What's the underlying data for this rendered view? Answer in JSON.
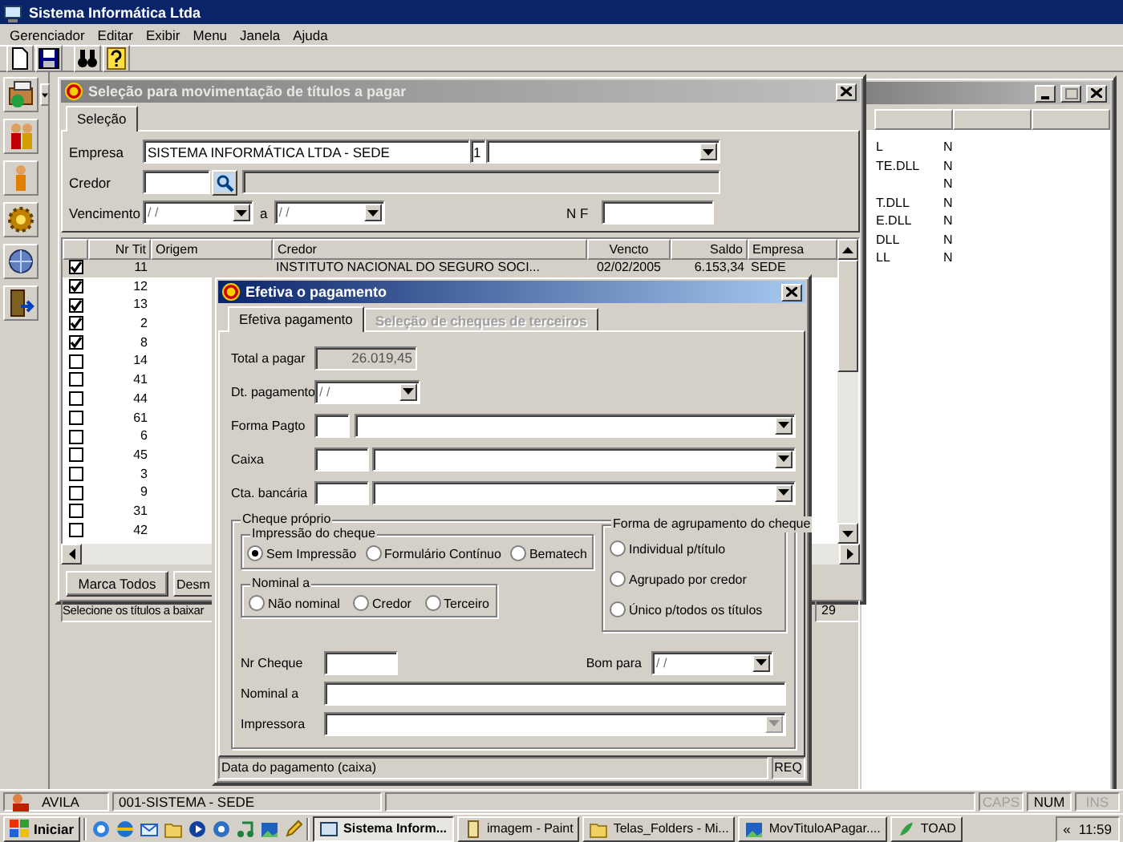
{
  "app": {
    "title": "Sistema Informática Ltda",
    "menu": [
      "Gerenciador",
      "Editar",
      "Exibir",
      "Menu",
      "Janela",
      "Ajuda"
    ]
  },
  "background_window": {
    "rows": [
      {
        "column_1": "L",
        "column_2": "N"
      },
      {
        "column_1": "TE.DLL",
        "column_2": "N"
      },
      {
        "column_2": "N"
      },
      {
        "column_1": "T.DLL",
        "column_2": "N"
      },
      {
        "column_1": "E.DLL",
        "column_2": "N"
      },
      {
        "column_1": "DLL",
        "column_2": "N"
      },
      {
        "column_1": "LL",
        "column_2": "N"
      }
    ]
  },
  "selection_window": {
    "title": "Seleção para movimentação de títulos a pagar",
    "tabs": [
      {
        "label": "Seleção",
        "selected": true
      }
    ],
    "empresa": {
      "label": "Empresa",
      "value": "SISTEMA INFORMÁTICA LTDA - SEDE",
      "code": "1"
    },
    "credor": {
      "label": "Credor"
    },
    "vencimento": {
      "label": "Vencimento",
      "from": {
        "placeholder": "/  /"
      },
      "separator": "a",
      "to": {
        "placeholder": "/  /"
      }
    },
    "nf": {
      "label": "N F"
    },
    "table": {
      "columns": [
        "Nr Tit",
        "Origem",
        "Credor",
        "Vencto",
        "Saldo",
        "Empresa"
      ],
      "rows": [
        {
          "checked": true,
          "selected": true,
          "nr_tit": "11",
          "credor": "INSTITUTO NACIONAL DO SEGURO SOCI...",
          "vencto": "02/02/2005",
          "saldo": "6.153,34",
          "empresa": "SEDE"
        },
        {
          "checked": true,
          "selected": false,
          "nr_tit": "12"
        },
        {
          "checked": true,
          "selected": false,
          "nr_tit": "13"
        },
        {
          "checked": true,
          "selected": false,
          "nr_tit": "2"
        },
        {
          "checked": true,
          "selected": false,
          "nr_tit": "8"
        },
        {
          "checked": false,
          "selected": false,
          "nr_tit": "14"
        },
        {
          "checked": false,
          "selected": false,
          "nr_tit": "41"
        },
        {
          "checked": false,
          "selected": false,
          "nr_tit": "44"
        },
        {
          "checked": false,
          "selected": false,
          "nr_tit": "61"
        },
        {
          "checked": false,
          "selected": false,
          "nr_tit": "6"
        },
        {
          "checked": false,
          "selected": false,
          "nr_tit": "45"
        },
        {
          "checked": false,
          "selected": false,
          "nr_tit": "3"
        },
        {
          "checked": false,
          "selected": false,
          "nr_tit": "9"
        },
        {
          "checked": false,
          "selected": false,
          "nr_tit": "31"
        },
        {
          "checked": false,
          "selected": false,
          "nr_tit": "42"
        }
      ]
    },
    "buttons": [
      "Marca Todos",
      "Desm"
    ],
    "status": "Selecione os títulos a baixar",
    "count": "29"
  },
  "dialog": {
    "title": "Efetiva o pagamento",
    "tabs": [
      {
        "label": "Efetiva pagamento",
        "selected": true,
        "disabled": false
      },
      {
        "label": "Seleção de cheques de terceiros",
        "selected": false,
        "disabled": true
      }
    ],
    "total": {
      "label": "Total a pagar",
      "value": "26.019,45"
    },
    "dt_pagamento": {
      "label": "Dt. pagamento",
      "placeholder": "/  /"
    },
    "lookups": [
      {
        "label": "Forma Pagto"
      },
      {
        "label": "Caixa"
      },
      {
        "label": "Cta. bancária"
      }
    ],
    "cheque": {
      "title": "Cheque próprio",
      "impressao": {
        "title": "Impressão do cheque",
        "options": [
          {
            "label": "Sem Impressão",
            "selected": true
          },
          {
            "label": "Formulário Contínuo",
            "selected": false
          },
          {
            "label": "Bematech",
            "selected": false
          }
        ]
      },
      "nominal": {
        "title": "Nominal a",
        "options": [
          {
            "label": "Não nominal",
            "selected": false
          },
          {
            "label": "Credor",
            "selected": false
          },
          {
            "label": "Terceiro",
            "selected": false
          }
        ]
      },
      "agrupamento": {
        "title": "Forma de agrupamento do cheque",
        "options": [
          {
            "label": "Individual p/título",
            "selected": false
          },
          {
            "label": "Agrupado por credor",
            "selected": false
          },
          {
            "label": "Único p/todos os títulos",
            "selected": false
          }
        ]
      },
      "nr_cheque": {
        "label": "Nr Cheque"
      },
      "bom_para": {
        "label": "Bom para",
        "placeholder": "/  /"
      },
      "nominal_a": {
        "label": "Nominal a"
      },
      "impressora": {
        "label": "Impressora",
        "disabled": true
      }
    },
    "status": "Data do pagamento (caixa)",
    "status_flag": "REQ"
  },
  "status_bar": {
    "user": "AVILA",
    "company": "001-SISTEMA - SEDE",
    "indicators": [
      {
        "label": "CAPS",
        "on": false
      },
      {
        "label": "NUM",
        "on": true
      },
      {
        "label": "INS",
        "on": false
      }
    ]
  },
  "taskbar": {
    "start": "Iniciar",
    "tasks": [
      {
        "label": "Sistema Inform...",
        "selected": true
      },
      {
        "label": "imagem - Paint",
        "selected": false
      },
      {
        "label": "Telas_Folders - Mi...",
        "selected": false
      },
      {
        "label": "MovTituloAPagar....",
        "selected": false
      },
      {
        "label": "TOAD",
        "selected": false
      }
    ],
    "chevron": "«",
    "clock": "11:59"
  }
}
